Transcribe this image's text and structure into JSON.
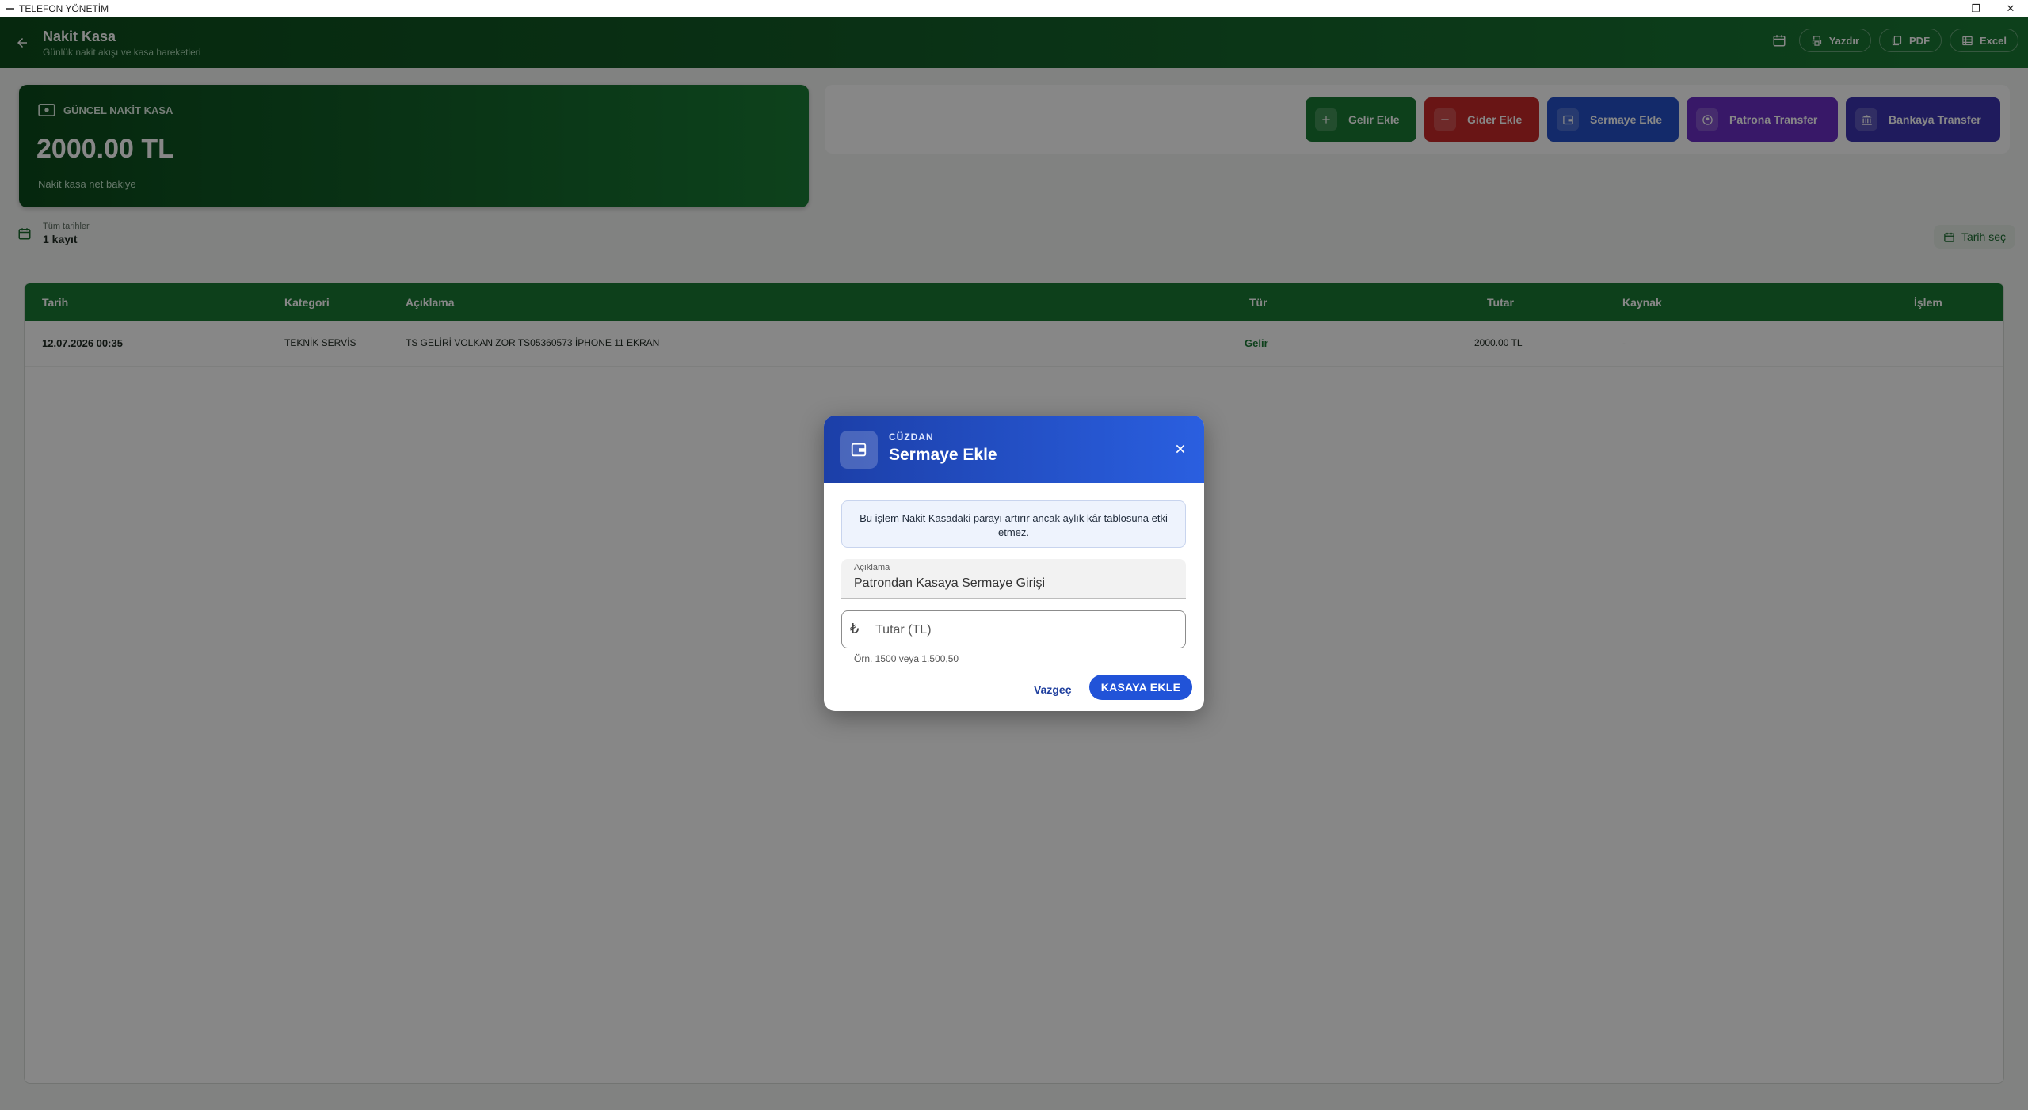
{
  "window": {
    "title": "TELEFON YÖNETİM",
    "controls": {
      "minimize": "–",
      "restore": "❐",
      "close": "✕"
    }
  },
  "header": {
    "title": "Nakit Kasa",
    "subtitle": "Günlük nakit akışı ve kasa hareketleri",
    "buttons": {
      "print": "Yazdır",
      "pdf": "PDF",
      "excel": "Excel"
    }
  },
  "balance": {
    "label": "GÜNCEL NAKİT KASA",
    "amount": "2000.00 TL",
    "note": "Nakit kasa net bakiye"
  },
  "actions": {
    "income": "Gelir Ekle",
    "expense": "Gider Ekle",
    "capital": "Sermaye Ekle",
    "to_boss": "Patrona Transfer",
    "to_bank": "Bankaya Transfer"
  },
  "filter": {
    "label": "Tüm tarihler",
    "count": "1 kayıt",
    "date_button": "Tarih seç"
  },
  "table": {
    "columns": [
      "Tarih",
      "Kategori",
      "Açıklama",
      "Tür",
      "Tutar",
      "Kaynak",
      "İşlem"
    ],
    "rows": [
      [
        "12.07.2026 00:35",
        "TEKNİK SERVİS",
        "TS GELİRİ VOLKAN ZOR TS05360573 İPHONE 11 EKRAN",
        "Gelir",
        "2000.00 TL",
        "-",
        ""
      ]
    ]
  },
  "dialog": {
    "overline": "CÜZDAN",
    "title": "Sermaye Ekle",
    "info": "Bu işlem Nakit Kasadaki parayı artırır ancak aylık kâr tablosuna etki etmez.",
    "description_label": "Açıklama",
    "description_value": "Patrondan Kasaya Sermaye Girişi",
    "amount_placeholder": "Tutar (TL)",
    "currency_symbol": "₺",
    "helper": "Örn. 1500 veya 1.500,50",
    "cancel": "Vazgeç",
    "submit": "KASAYA EKLE"
  },
  "colors": {
    "header_green": "#14602a",
    "income_green": "#1a7a34",
    "expense_red": "#c62828",
    "capital_blue": "#2450c8",
    "boss_purple": "#6a2ec4",
    "bank_indigo": "#3b33b0",
    "dialog_blue": "#2153d8"
  }
}
